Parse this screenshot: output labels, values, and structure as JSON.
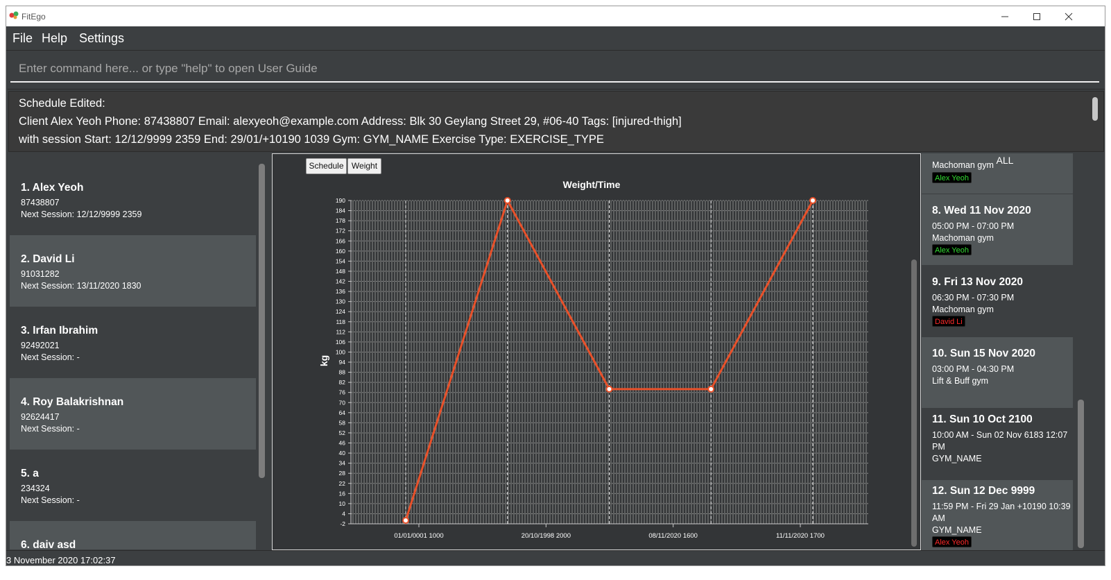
{
  "window": {
    "title": "FitEgo"
  },
  "menu": {
    "file": "File",
    "help": "Help",
    "settings": "Settings"
  },
  "command": {
    "placeholder": "Enter command here... or type \"help\" to open User Guide"
  },
  "result": {
    "line1": "Schedule Edited:",
    "line2": "Client Alex Yeoh Phone: 87438807 Email: alexyeoh@example.com Address: Blk 30 Geylang Street 29, #06-40 Tags: [injured-thigh]",
    "line3": " with session  Start: 12/12/9999 2359 End: 29/01/+10190 1039 Gym: GYM_NAME Exercise Type: EXERCISE_TYPE"
  },
  "clients": [
    {
      "name": "1.  Alex Yeoh",
      "phone": "87438807",
      "session": "Next Session: 12/12/9999 2359"
    },
    {
      "name": "2.  David Li",
      "phone": "91031282",
      "session": "Next Session: 13/11/2020 1830"
    },
    {
      "name": "3.  Irfan Ibrahim",
      "phone": "92492021",
      "session": "Next Session:  -"
    },
    {
      "name": "4.  Roy Balakrishnan",
      "phone": "92624417",
      "session": "Next Session:  -"
    },
    {
      "name": "5.  a",
      "phone": "234324",
      "session": "Next Session:  -"
    },
    {
      "name": "6.  daiv asd",
      "phone": "",
      "session": ""
    }
  ],
  "tabs": {
    "schedule": "Schedule",
    "weight": "Weight"
  },
  "chart_data": {
    "type": "line",
    "title": "Weight/Time",
    "ylabel": "kg",
    "xlabel": "",
    "ylim": [
      -2,
      190
    ],
    "yticks": [
      -2,
      4,
      10,
      16,
      22,
      28,
      34,
      40,
      46,
      52,
      58,
      64,
      70,
      76,
      82,
      88,
      94,
      100,
      106,
      112,
      118,
      124,
      130,
      136,
      142,
      148,
      154,
      160,
      166,
      172,
      178,
      184,
      190
    ],
    "xtick_labels": [
      "01/01/0001 1000",
      "20/10/1998 2000",
      "08/11/2020 1600",
      "11/11/2020 1700"
    ],
    "series": [
      {
        "values": [
          0,
          190,
          78,
          78,
          190
        ]
      }
    ],
    "color": "#e8512a",
    "grid": true
  },
  "schedule": {
    "header": "ALL",
    "partial_top": {
      "line": "Machoman gym",
      "tag": "Alex Yeoh"
    },
    "items": [
      {
        "title": "8.  Wed 11 Nov 2020",
        "time": "05:00 PM - 07:00 PM",
        "gym": "Machoman gym",
        "tag": "Alex Yeoh",
        "tag_color": "green"
      },
      {
        "title": "9.  Fri 13 Nov 2020",
        "time": "06:30 PM - 07:30 PM",
        "gym": "Machoman gym",
        "tag": "David Li",
        "tag_color": "red"
      },
      {
        "title": "10.  Sun 15 Nov 2020",
        "time": "03:00 PM - 04:30 PM",
        "gym": "Lift & Buff gym",
        "tag": "",
        "tag_color": ""
      },
      {
        "title": "11.  Sun 10 Oct 2100",
        "time": "10:00 AM - Sun 02 Nov 6183 12:07 PM",
        "gym": "GYM_NAME",
        "tag": "",
        "tag_color": ""
      },
      {
        "title": "12.  Sun 12 Dec 9999",
        "time": "11:59 PM - Fri 29 Jan +10190 10:39 AM",
        "gym": "GYM_NAME",
        "tag": "Alex Yeoh",
        "tag_color": "red"
      }
    ]
  },
  "status": {
    "datetime": "3 November 2020 17:02:37"
  }
}
